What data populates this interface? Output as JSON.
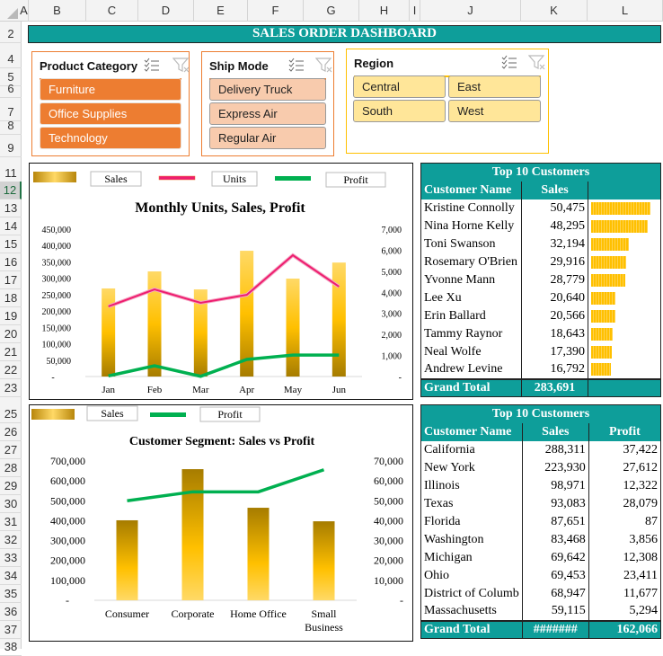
{
  "sheet": {
    "columns": [
      "A",
      "B",
      "C",
      "D",
      "E",
      "F",
      "G",
      "H",
      "I",
      "J",
      "K",
      "L"
    ],
    "rows": [
      "2",
      "4",
      "5",
      "6",
      "7",
      "8",
      "9",
      "11",
      "12",
      "13",
      "14",
      "15",
      "16",
      "17",
      "18",
      "19",
      "20",
      "21",
      "22",
      "23",
      "25",
      "26",
      "27",
      "28",
      "29",
      "30",
      "31",
      "32",
      "33",
      "34",
      "35",
      "36",
      "37",
      "38"
    ],
    "selected_row": "12"
  },
  "banner": {
    "title": "SALES ORDER DASHBOARD",
    "color": "#0e9e9a"
  },
  "slicers": {
    "product_category": {
      "title": "Product Category",
      "items": [
        "Furniture",
        "Office Supplies",
        "Technology"
      ]
    },
    "ship_mode": {
      "title": "Ship Mode",
      "items": [
        "Delivery Truck",
        "Express Air",
        "Regular Air"
      ]
    },
    "region": {
      "title": "Region",
      "items": [
        "Central",
        "East",
        "South",
        "West"
      ]
    }
  },
  "chart_data": [
    {
      "type": "bar",
      "title": "Monthly Units, Sales, Profit",
      "categories": [
        "Jan",
        "Feb",
        "Mar",
        "Apr",
        "May",
        "Jun"
      ],
      "series": [
        {
          "name": "Sales",
          "type": "bar",
          "axis": "left",
          "values": [
            269000,
            321000,
            266000,
            384000,
            299000,
            348000
          ]
        },
        {
          "name": "Units",
          "type": "line",
          "axis": "right",
          "color": "#ee1d6f",
          "values": [
            3330,
            4140,
            3500,
            3880,
            5760,
            4270
          ]
        },
        {
          "name": "Profit",
          "type": "line",
          "axis": "right",
          "color": "#00b050",
          "values": [
            30,
            510,
            10,
            810,
            1020,
            1020
          ]
        }
      ],
      "y_left": {
        "ylim": [
          0,
          450000
        ],
        "ticks": [
          "-",
          "50,000",
          "100,000",
          "150,000",
          "200,000",
          "250,000",
          "300,000",
          "350,000",
          "400,000",
          "450,000"
        ]
      },
      "y_right": {
        "ylim": [
          0,
          7000
        ],
        "ticks": [
          "-",
          "1,000",
          "2,000",
          "3,000",
          "4,000",
          "5,000",
          "6,000",
          "7,000"
        ]
      },
      "legend": [
        "Sales",
        "Units",
        "Profit"
      ],
      "legend_position": "top",
      "grid": false
    },
    {
      "type": "bar",
      "title": "Customer Segment: Sales vs Profit",
      "categories": [
        "Consumer",
        "Corporate",
        "Home Office",
        "Small Business"
      ],
      "category_lines": [
        [
          "Consumer"
        ],
        [
          "Corporate"
        ],
        [
          "Home Office"
        ],
        [
          "Small",
          "Business"
        ]
      ],
      "series": [
        {
          "name": "Sales",
          "type": "bar",
          "axis": "left",
          "values": [
            402000,
            659000,
            465000,
            397000
          ]
        },
        {
          "name": "Profit",
          "type": "line",
          "axis": "right",
          "color": "#00b050",
          "values": [
            50000,
            54500,
            54500,
            65600
          ]
        }
      ],
      "y_left": {
        "ylim": [
          0,
          700000
        ],
        "ticks": [
          "-",
          "100,000",
          "200,000",
          "300,000",
          "400,000",
          "500,000",
          "600,000",
          "700,000"
        ]
      },
      "y_right": {
        "ylim": [
          0,
          70000
        ],
        "ticks": [
          "-",
          "10,000",
          "20,000",
          "30,000",
          "40,000",
          "50,000",
          "60,000",
          "70,000"
        ]
      },
      "legend": [
        "Sales",
        "Profit"
      ],
      "legend_position": "top",
      "grid": false
    }
  ],
  "customers_table": {
    "title": "Top 10 Customers",
    "headers": [
      "Customer Name",
      "Sales",
      ""
    ],
    "rows": [
      {
        "name": "Kristine Connolly",
        "sales": "50,475",
        "value": 50475
      },
      {
        "name": "Nina Horne Kelly",
        "sales": "48,295",
        "value": 48295
      },
      {
        "name": "Toni Swanson",
        "sales": "32,194",
        "value": 32194
      },
      {
        "name": "Rosemary O'Brien",
        "sales": "29,916",
        "value": 29916
      },
      {
        "name": "Yvonne Mann",
        "sales": "28,779",
        "value": 28779
      },
      {
        "name": "Lee Xu",
        "sales": "20,640",
        "value": 20640
      },
      {
        "name": "Erin Ballard",
        "sales": "20,566",
        "value": 20566
      },
      {
        "name": "Tammy Raynor",
        "sales": "18,643",
        "value": 18643
      },
      {
        "name": "Neal Wolfe",
        "sales": "17,390",
        "value": 17390
      },
      {
        "name": "Andrew Levine",
        "sales": "16,792",
        "value": 16792
      }
    ],
    "total_label": "Grand Total",
    "total_sales": "283,691"
  },
  "states_table": {
    "title": "Top 10 Customers",
    "headers": [
      "Customer Name",
      "Sales",
      "Profit"
    ],
    "rows": [
      {
        "name": "California",
        "sales": "288,311",
        "profit": "37,422"
      },
      {
        "name": "New York",
        "sales": "223,930",
        "profit": "27,612"
      },
      {
        "name": "Illinois",
        "sales": "98,971",
        "profit": "12,322"
      },
      {
        "name": "Texas",
        "sales": "93,083",
        "profit": "28,079"
      },
      {
        "name": "Florida",
        "sales": "87,651",
        "profit": "87"
      },
      {
        "name": "Washington",
        "sales": "83,468",
        "profit": "3,856"
      },
      {
        "name": "Michigan",
        "sales": "69,642",
        "profit": "12,308"
      },
      {
        "name": "Ohio",
        "sales": "69,453",
        "profit": "23,411"
      },
      {
        "name": "District of Columb",
        "sales": "68,947",
        "profit": "11,677"
      },
      {
        "name": "Massachusetts",
        "sales": "59,115",
        "profit": "5,294"
      }
    ],
    "total_label": "Grand Total",
    "total_sales": "#######",
    "total_profit": "162,066"
  }
}
